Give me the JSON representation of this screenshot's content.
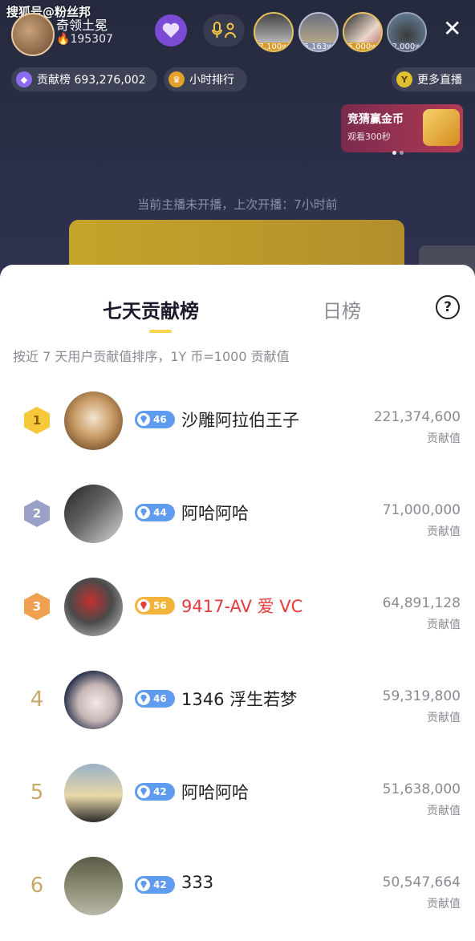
{
  "watermark": "搜狐号@粉丝邦",
  "streamer": {
    "name": "奇领土冕",
    "heat": "195307"
  },
  "top_viewers": [
    {
      "badge": "7,100w"
    },
    {
      "badge": "5,163w"
    },
    {
      "badge": "5,000w"
    },
    {
      "badge": "2,000w"
    }
  ],
  "bar": {
    "contribution_label": "贡献榜 693,276,002",
    "hourly_rank": "小时排行",
    "more_live": "更多直播"
  },
  "promo": {
    "title": "竞猜赢金币",
    "subtitle": "观看300秒"
  },
  "offline_notice": "当前主播未开播，上次开播：7小时前",
  "sheet": {
    "tab_weekly": "七天贡献榜",
    "tab_daily": "日榜",
    "help": "?",
    "description": "按近 7 天用户贡献值排序，1Y 币=1000 贡献值"
  },
  "leaderboard": [
    {
      "rank": "1",
      "level": "46",
      "name": "沙雕阿拉伯王子",
      "score": "221,374,600",
      "unit": "贡献值"
    },
    {
      "rank": "2",
      "level": "44",
      "name": "阿哈阿哈",
      "score": "71,000,000",
      "unit": "贡献值"
    },
    {
      "rank": "3",
      "level": "56",
      "name": "9417-AV 爱 VC",
      "score": "64,891,128",
      "unit": "贡献值"
    },
    {
      "rank": "4",
      "level": "46",
      "name": "1346 浮生若梦",
      "score": "59,319,800",
      "unit": "贡献值"
    },
    {
      "rank": "5",
      "level": "42",
      "name": "阿哈阿哈",
      "score": "51,638,000",
      "unit": "贡献值"
    },
    {
      "rank": "6",
      "level": "42",
      "name": "333",
      "score": "50,547,664",
      "unit": "贡献值"
    }
  ]
}
